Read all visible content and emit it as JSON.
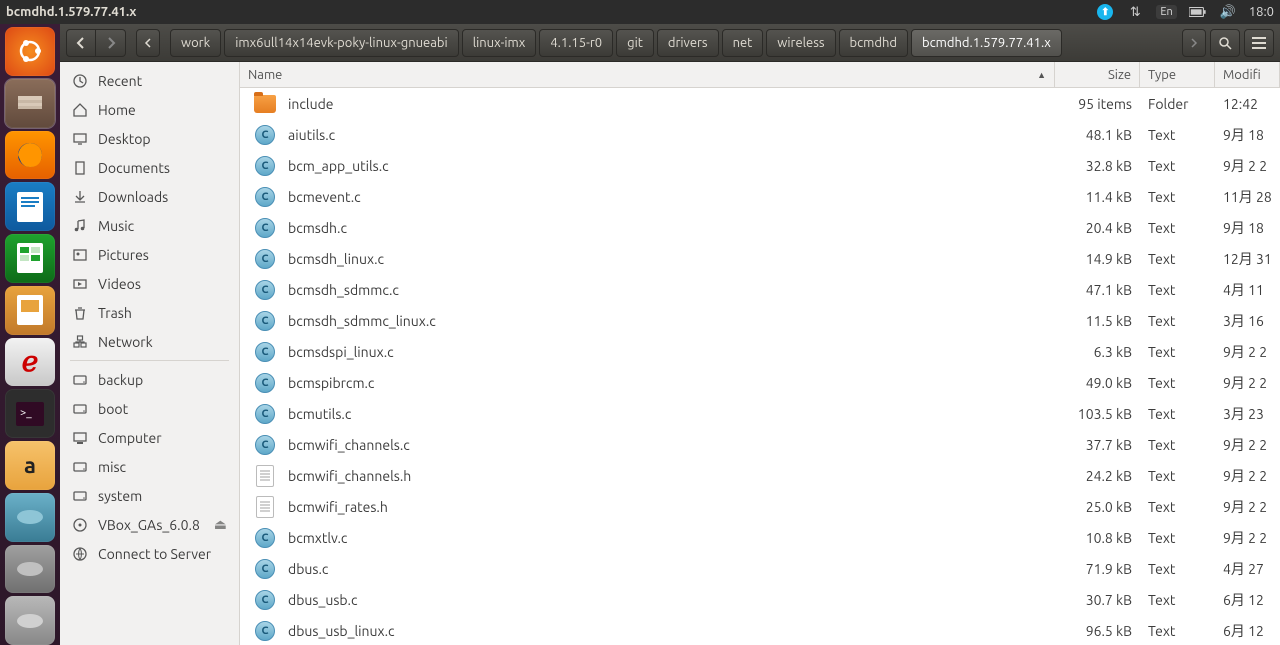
{
  "window_title": "bcmdhd.1.579.77.41.x",
  "top": {
    "lang": "En",
    "time": "18:0"
  },
  "toolbar": {
    "crumbs": [
      "work",
      "imx6ull14x14evk-poky-linux-gnueabi",
      "linux-imx",
      "4.1.15-r0",
      "git",
      "drivers",
      "net",
      "wireless",
      "bcmdhd",
      "bcmdhd.1.579.77.41.x"
    ]
  },
  "sidebar": {
    "places": [
      {
        "label": "Recent",
        "icon": "clock"
      },
      {
        "label": "Home",
        "icon": "home"
      },
      {
        "label": "Desktop",
        "icon": "desktop"
      },
      {
        "label": "Documents",
        "icon": "doc"
      },
      {
        "label": "Downloads",
        "icon": "dl"
      },
      {
        "label": "Music",
        "icon": "music"
      },
      {
        "label": "Pictures",
        "icon": "pic"
      },
      {
        "label": "Videos",
        "icon": "vid"
      },
      {
        "label": "Trash",
        "icon": "trash"
      },
      {
        "label": "Network",
        "icon": "net"
      }
    ],
    "devices": [
      {
        "label": "backup",
        "icon": "hd"
      },
      {
        "label": "boot",
        "icon": "hd"
      },
      {
        "label": "Computer",
        "icon": "comp"
      },
      {
        "label": "misc",
        "icon": "hd"
      },
      {
        "label": "system",
        "icon": "hd"
      },
      {
        "label": "VBox_GAs_6.0.8",
        "icon": "cd",
        "eject": true
      },
      {
        "label": "Connect to Server",
        "icon": "conn"
      }
    ]
  },
  "columns": {
    "name": "Name",
    "size": "Size",
    "type": "Type",
    "modified": "Modifi"
  },
  "files": [
    {
      "name": "include",
      "size": "95 items",
      "type": "Folder",
      "mod": "12:42",
      "icon": "folder"
    },
    {
      "name": "aiutils.c",
      "size": "48.1 kB",
      "type": "Text",
      "mod": "9月 18",
      "icon": "c"
    },
    {
      "name": "bcm_app_utils.c",
      "size": "32.8 kB",
      "type": "Text",
      "mod": "9月 2 2",
      "icon": "c"
    },
    {
      "name": "bcmevent.c",
      "size": "11.4 kB",
      "type": "Text",
      "mod": "11月 28",
      "icon": "c"
    },
    {
      "name": "bcmsdh.c",
      "size": "20.4 kB",
      "type": "Text",
      "mod": "9月 18",
      "icon": "c"
    },
    {
      "name": "bcmsdh_linux.c",
      "size": "14.9 kB",
      "type": "Text",
      "mod": "12月 31",
      "icon": "c"
    },
    {
      "name": "bcmsdh_sdmmc.c",
      "size": "47.1 kB",
      "type": "Text",
      "mod": "4月 11",
      "icon": "c"
    },
    {
      "name": "bcmsdh_sdmmc_linux.c",
      "size": "11.5 kB",
      "type": "Text",
      "mod": "3月 16",
      "icon": "c"
    },
    {
      "name": "bcmsdspi_linux.c",
      "size": "6.3 kB",
      "type": "Text",
      "mod": "9月 2 2",
      "icon": "c"
    },
    {
      "name": "bcmspibrcm.c",
      "size": "49.0 kB",
      "type": "Text",
      "mod": "9月 2 2",
      "icon": "c"
    },
    {
      "name": "bcmutils.c",
      "size": "103.5 kB",
      "type": "Text",
      "mod": "3月 23",
      "icon": "c"
    },
    {
      "name": "bcmwifi_channels.c",
      "size": "37.7 kB",
      "type": "Text",
      "mod": "9月 2 2",
      "icon": "c"
    },
    {
      "name": "bcmwifi_channels.h",
      "size": "24.2 kB",
      "type": "Text",
      "mod": "9月 2 2",
      "icon": "h"
    },
    {
      "name": "bcmwifi_rates.h",
      "size": "25.0 kB",
      "type": "Text",
      "mod": "9月 2 2",
      "icon": "h"
    },
    {
      "name": "bcmxtlv.c",
      "size": "10.8 kB",
      "type": "Text",
      "mod": "9月 2 2",
      "icon": "c"
    },
    {
      "name": "dbus.c",
      "size": "71.9 kB",
      "type": "Text",
      "mod": "4月 27",
      "icon": "c"
    },
    {
      "name": "dbus_usb.c",
      "size": "30.7 kB",
      "type": "Text",
      "mod": "6月 12",
      "icon": "c"
    },
    {
      "name": "dbus_usb_linux.c",
      "size": "96.5 kB",
      "type": "Text",
      "mod": "6月 12",
      "icon": "c"
    }
  ]
}
